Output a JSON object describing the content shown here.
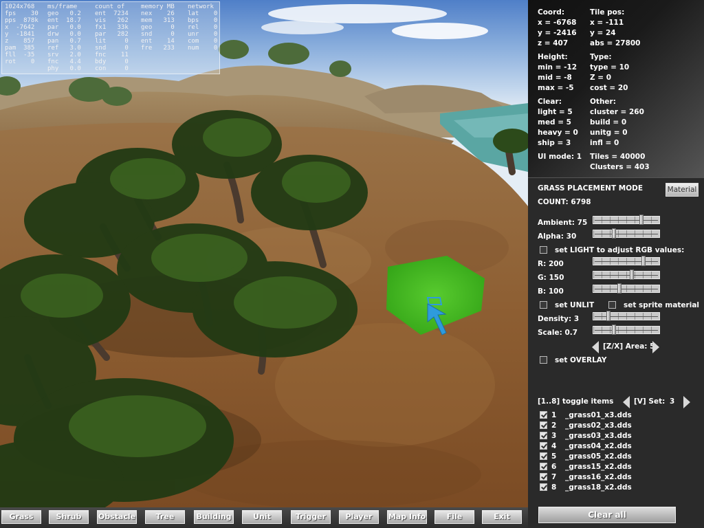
{
  "stats": {
    "col1": [
      "1024x768",
      "fps    30",
      "pps  878k",
      "x  -7642",
      "y  -1841",
      "z    857",
      "pam  385",
      "fll  -35",
      "rot    0"
    ],
    "col2": [
      "ms/frame",
      "geo   0.2",
      "ent  18.7",
      "par   0.0",
      "drw   0.0",
      "pan   0.7",
      "ref   3.0",
      "srv   2.0",
      "fnc   4.4",
      "phy   0.0"
    ],
    "col3": [
      "count of",
      "ent  7234",
      "vis   262",
      "fx1   33k",
      "par   282",
      "lit     0",
      "snd     0",
      "fnc    11",
      "bdy     0",
      "con     0"
    ],
    "col4": [
      "memory MB",
      "nex    26",
      "mem   313",
      "geo     0",
      "snd     0",
      "ent    14",
      "fre   233"
    ],
    "col5": [
      "network",
      "lat    0",
      "bps    0",
      "rel    0",
      "unr    0",
      "com    0",
      "num    0"
    ]
  },
  "info": {
    "coord_label": "Coord:",
    "coord_x": "x = -6768",
    "coord_y": "y = -2416",
    "coord_z": "z = 407",
    "tile_label": "Tile pos:",
    "tile_x": "x = -111",
    "tile_y": "y = 24",
    "tile_abs": "abs = 27800",
    "height_label": "Height:",
    "height_min": "min = -12",
    "height_mid": "mid = -8",
    "height_max": "max = -5",
    "type_label": "Type:",
    "type_type": "type = 10",
    "type_z": "Z = 0",
    "type_cost": "cost = 20",
    "clear_label": "Clear:",
    "clear_light": "light = 5",
    "clear_med": "med = 5",
    "clear_heavy": "heavy = 0",
    "clear_ship": "ship = 3",
    "other_label": "Other:",
    "other_cluster": "cluster = 260",
    "other_build": "build = 0",
    "other_unitg": "unitg = 0",
    "other_infl": "infl = 0",
    "ui_mode": "UI mode: 1",
    "tiles": "Tiles = 40000",
    "clusters": "Clusters = 403"
  },
  "grass": {
    "mode_title": "GRASS PLACEMENT MODE",
    "material_button": "Material",
    "count": "COUNT: 6798",
    "ambient_label": "Ambient: 75",
    "ambient_value": 0.75,
    "alpha_label": "Alpha: 30",
    "alpha_value": 0.3,
    "light_rgb_label": "set LIGHT to adjust RGB values:",
    "light_rgb_checked": false,
    "r_label": "R: 200",
    "r_value": 0.784,
    "g_label": "G: 150",
    "g_value": 0.588,
    "b_label": "B: 100",
    "b_value": 0.392,
    "unlit_label": "set UNLIT",
    "unlit_checked": false,
    "sprite_label": "set sprite material",
    "sprite_checked": false,
    "density_label": "Density: 3",
    "density_value": 0.2,
    "scale_label": "Scale: 0.7",
    "scale_value": 0.3,
    "area_label": "[Z/X] Area: 5",
    "overlay_label": "set OVERLAY",
    "overlay_checked": false,
    "toggle_label": "[1..8] toggle items",
    "set_label": "[V] Set:",
    "set_value": "3",
    "items": [
      {
        "num": "1",
        "name": "_grass01_x3.dds",
        "checked": true
      },
      {
        "num": "2",
        "name": "_grass02_x3.dds",
        "checked": true
      },
      {
        "num": "3",
        "name": "_grass03_x3.dds",
        "checked": true
      },
      {
        "num": "4",
        "name": "_grass04_x2.dds",
        "checked": true
      },
      {
        "num": "5",
        "name": "_grass05_x2.dds",
        "checked": true
      },
      {
        "num": "6",
        "name": "_grass15_x2.dds",
        "checked": true
      },
      {
        "num": "7",
        "name": "_grass16_x2.dds",
        "checked": true
      },
      {
        "num": "8",
        "name": "_grass18_x2.dds",
        "checked": true
      }
    ],
    "clear_all": "Clear all"
  },
  "toolbar": [
    "Grass",
    "Shrub",
    "Obstacle",
    "Tree",
    "Building",
    "Unit",
    "Trigger",
    "Player",
    "Map Info",
    "File",
    "Exit"
  ],
  "colors": {
    "ground": "#8a5f33",
    "grass_brush": "#3fbf1f",
    "cursor": "#2e9bdc",
    "water": "#5aa6a3"
  }
}
